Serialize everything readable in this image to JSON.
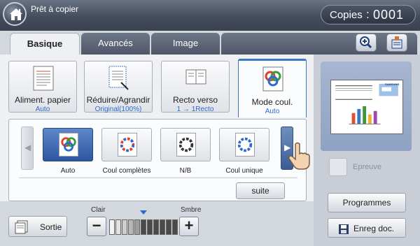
{
  "header": {
    "title": "Prêt à copier",
    "copies_label": "Copies",
    "copies_colon": ":",
    "copies_value": "0001"
  },
  "tabs": [
    {
      "label": "Basique",
      "active": true
    },
    {
      "label": "Avancés",
      "active": false
    },
    {
      "label": "Image",
      "active": false
    }
  ],
  "functions": [
    {
      "label": "Aliment. papier",
      "value": "Auto"
    },
    {
      "label": "Réduire/Agrandir",
      "value": "Original(100%)"
    },
    {
      "label": "Recto verso",
      "value": "1 → 1Recto"
    },
    {
      "label": "Mode coul.",
      "value": "Auto",
      "active": true
    }
  ],
  "color_options": [
    {
      "label": "Auto",
      "selected": true
    },
    {
      "label": "Coul complètes",
      "selected": false
    },
    {
      "label": "N/B",
      "selected": false
    },
    {
      "label": "Coul unique",
      "selected": false
    }
  ],
  "suite_label": "suite",
  "output": {
    "label": "Sortie"
  },
  "density": {
    "min_label": "Clair",
    "max_label": "Smbre",
    "level": 6,
    "steps": 11
  },
  "right": {
    "epreuve_label": "Epreuve",
    "programmes_label": "Programmes",
    "enreg_label": "Enreg doc."
  },
  "colors": {
    "accent": "#2b6bd1",
    "topbar": "#454d5c",
    "selected": "#2c56a2"
  }
}
